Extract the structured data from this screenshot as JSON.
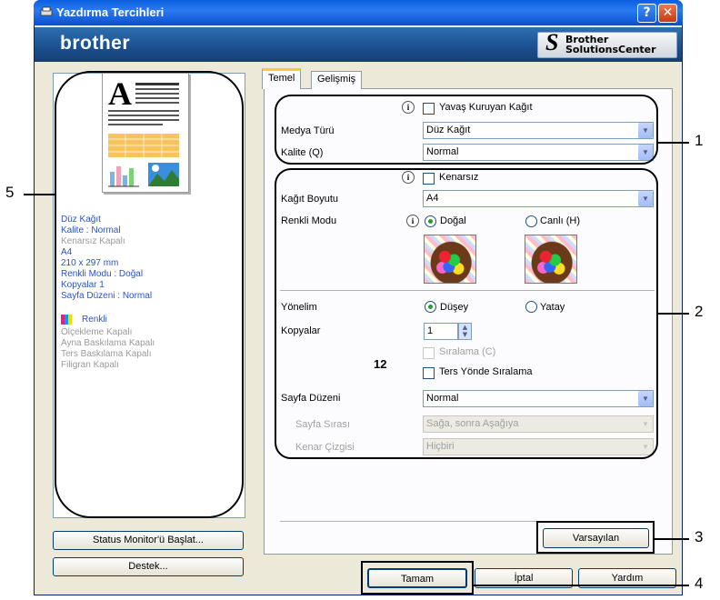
{
  "window": {
    "title": "Yazdırma Tercihleri",
    "help": "?",
    "close": "✕"
  },
  "brand": {
    "logo": "brother",
    "solutions_line1": "Brother",
    "solutions_line2": "SolutionsCenter"
  },
  "summary": {
    "lines": [
      "Düz Kağıt",
      "Kalite : Normal",
      "Kenarsız Kapalı",
      "A4",
      "210 x 297 mm",
      "Renkli Modu : Doğal",
      "Kopyalar 1",
      "Sayfa Düzeni : Normal"
    ],
    "color_label": "Renkli",
    "gray_lines": [
      "Ölçekleme Kapalı",
      "Ayna Baskılama Kapalı",
      "Ters Baskılama Kapalı",
      "Filigran Kapalı"
    ]
  },
  "left_buttons": {
    "status_monitor": "Status Monitor'ü Başlat...",
    "support": "Destek..."
  },
  "tabs": [
    "Temel",
    "Gelişmiş"
  ],
  "settings": {
    "slow_drying": "Yavaş Kuruyan Kağıt",
    "media_type_label": "Medya Türü",
    "media_type_value": "Düz Kağıt",
    "quality_label": "Kalite (Q)",
    "quality_value": "Normal",
    "borderless": "Kenarsız",
    "paper_size_label": "Kağıt Boyutu",
    "paper_size_value": "A4",
    "color_mode_label": "Renkli Modu",
    "color_natural": "Doğal",
    "color_vivid": "Canlı (H)",
    "orientation_label": "Yönelim",
    "portrait": "Düşey",
    "landscape": "Yatay",
    "copies_label": "Kopyalar",
    "copies_value": "1",
    "collate": "Sıralama (C)",
    "reverse_order": "Ters Yönde Sıralama",
    "collate_icon_text": "12",
    "page_layout_label": "Sayfa Düzeni",
    "page_layout_value": "Normal",
    "page_order_label": "Sayfa Sırası",
    "page_order_value": "Sağa, sonra Aşağıya",
    "border_line_label": "Kenar Çizgisi",
    "border_line_value": "Hiçbiri"
  },
  "buttons": {
    "default": "Varsayılan",
    "ok": "Tamam",
    "cancel": "İptal",
    "help": "Yardım"
  },
  "callouts": [
    "1",
    "2",
    "3",
    "4",
    "5"
  ]
}
